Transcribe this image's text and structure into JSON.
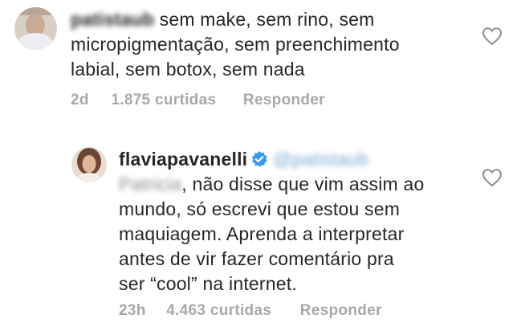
{
  "comment1": {
    "username": "patistaub",
    "text_part1": "sem make, sem rino, sem",
    "text_line2": "micropigmentação, sem preenchimento",
    "text_line3": "labial, sem botox, sem nada",
    "time": "2d",
    "likes": "1.875 curtidas",
    "reply_label": "Responder",
    "like_icon": "heart-outline-icon"
  },
  "comment2": {
    "username": "flaviapavanelli",
    "verified_icon": "verified-badge-icon",
    "verified_color": "#3897f0",
    "mention": "@patistaub",
    "mention_name": "Patricia",
    "text_part1": ", não disse que vim assim ao",
    "text_line2": "mundo, só escrevi que estou sem",
    "text_line3": "maquiagem. Aprenda a interpretar",
    "text_line4": "antes de vir fazer comentário pra",
    "text_line5": "ser “cool” na internet.",
    "time": "23h",
    "likes": "4.463 curtidas",
    "reply_label": "Responder",
    "like_icon": "heart-outline-icon"
  }
}
